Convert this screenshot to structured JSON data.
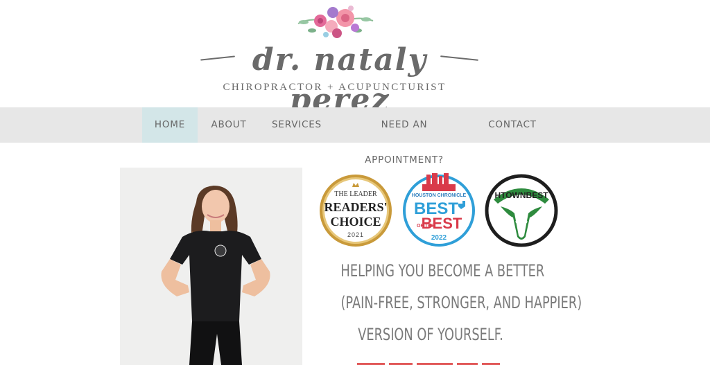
{
  "logo": {
    "name": "dr. nataly perez",
    "tagline": "CHIROPRACTOR + ACUPUNCTURIST"
  },
  "nav": {
    "items": [
      {
        "label": "HOME",
        "active": true
      },
      {
        "label": "ABOUT",
        "active": false
      },
      {
        "label": "SERVICES",
        "active": false
      },
      {
        "label": "NEED AN APPOINTMENT?",
        "active": false
      },
      {
        "label": "CONTACT",
        "active": false
      }
    ]
  },
  "badges": {
    "leader": {
      "top": "THE LEADER",
      "line1": "READERS'",
      "line2": "CHOICE",
      "year": "2021"
    },
    "chronicle": {
      "top": "HOUSTON CHRONICLE",
      "line1": "BEST",
      "of_the": "OF THE",
      "line2": "BEST",
      "year": "2022"
    },
    "htown": {
      "label": "HTOWNBEST"
    }
  },
  "headline": {
    "line1": "HELPING YOU BECOME A BETTER",
    "line2": "(PAIN-FREE, STRONGER, AND HAPPIER)",
    "line3": "VERSION OF YOURSELF."
  },
  "colors": {
    "nav_bg": "#e7e7e7",
    "nav_active_bg": "#d3e6e8",
    "text_gray": "#6a6a6a",
    "accent_red": "#d93030",
    "chronicle_blue": "#2f9fd8",
    "htown_green": "#2e8b3e"
  }
}
